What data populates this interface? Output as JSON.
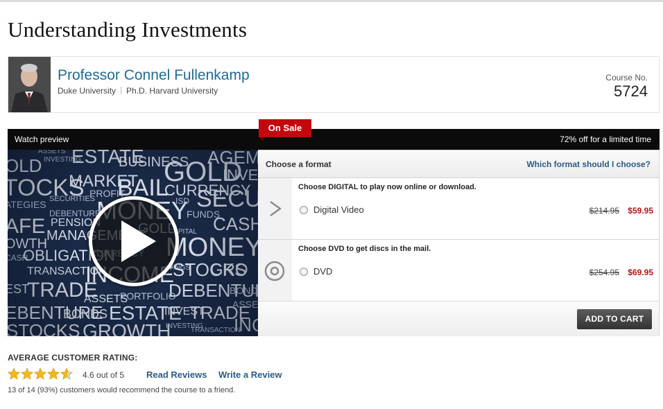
{
  "page": {
    "title": "Understanding Investments"
  },
  "professor": {
    "name": "Professor Connel Fullenkamp",
    "affiliation": "Duke University",
    "degree": "Ph.D. Harvard University",
    "course_label": "Course No.",
    "course_number": "5724"
  },
  "sale_bar": {
    "watch_preview": "Watch preview",
    "badge": "On Sale",
    "discount_text": "72% off for a limited time"
  },
  "video": {
    "words": [
      "ASSETS",
      "INVESTING",
      "ESTATE",
      "BUSINESS",
      "GOLD",
      "AGEMENT",
      "INVEST",
      "OLD",
      "TOCKS",
      "MARKET",
      "BAIL",
      "CURRENCY",
      "SECUR",
      "ATEGIES",
      "SECURITIES",
      "PROFIT",
      "MONEY",
      "ISD",
      "FUNDS",
      "CASH",
      "AFE",
      "DEBENTURE",
      "PENSION",
      "OWTH",
      "MANAGEMENT",
      "GOLD",
      "CAPITAL",
      "MONEY",
      "CASH",
      "OBLIGATION",
      "CURRENCY",
      "AVINGS",
      "STOCKS",
      "GRO",
      "TRANSACTION",
      "INCOME",
      "DEBENTURE",
      "BONDS",
      "EST",
      "TRADE",
      "ASSETS",
      "PORTFOLIO",
      "EBENTURE",
      "BONDS",
      "ESTATE",
      "INVEST",
      "TRADE",
      "ASSETS",
      "STOCKS",
      "GROWTH",
      "INVESTING",
      "TRANSACTION",
      "INC"
    ]
  },
  "format": {
    "header": "Choose a format",
    "help_link": "Which format should I choose?",
    "options": [
      {
        "desc": "Choose DIGITAL to play now online or download.",
        "label": "Digital Video",
        "old_price": "$214.95",
        "new_price": "$59.95",
        "icon": "play-outline-icon"
      },
      {
        "desc": "Choose DVD to get discs in the mail.",
        "label": "DVD",
        "old_price": "$254.95",
        "new_price": "$69.95",
        "icon": "disc-icon"
      }
    ],
    "add_to_cart": "ADD TO CART"
  },
  "rating": {
    "title": "AVERAGE CUSTOMER RATING:",
    "value": 4.6,
    "text": "4.6 out of 5",
    "read_reviews": "Read Reviews",
    "write_review": "Write a Review",
    "recommend": "13 of 14 (93%) customers would recommend the course to a friend."
  },
  "colors": {
    "link": "#2b5b86",
    "sale_red": "#c2080e",
    "price_red": "#b3151b",
    "name_blue": "#1f6b8f",
    "star": "#f1b81c"
  }
}
